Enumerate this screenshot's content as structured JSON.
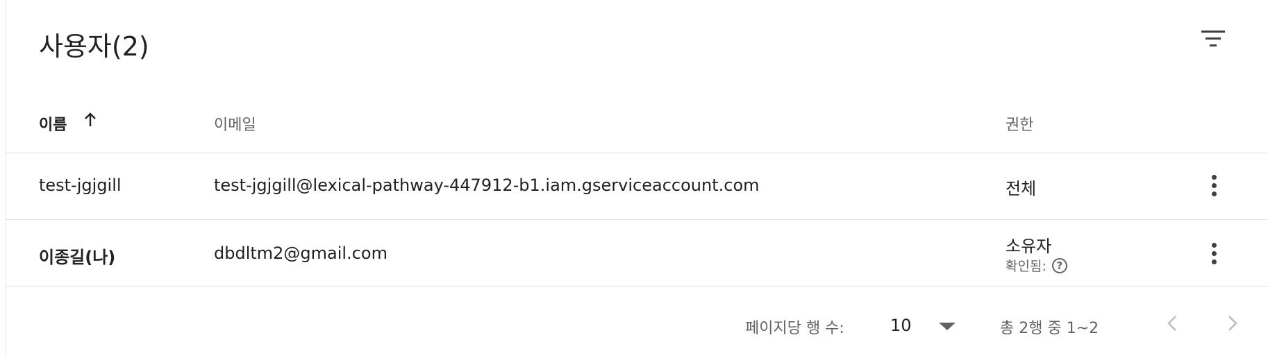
{
  "header": {
    "title": "사용자(2)",
    "filter_icon": "filter-list-icon"
  },
  "columns": {
    "name": "이름",
    "email": "이메일",
    "role": "권한",
    "sort_icon": "arrow-up-icon"
  },
  "rows": [
    {
      "name": "test-jgjgill",
      "email": "test-jgjgill@lexical-pathway-447912-b1.iam.gserviceaccount.com",
      "role": "전체"
    },
    {
      "name": "이종길(나)",
      "email": "dbdltm2@gmail.com",
      "role": "소유자",
      "role_sub": "확인됨:",
      "help_icon_text": "?"
    }
  ],
  "footer": {
    "rows_per_page_label": "페이지당 행 수:",
    "rows_per_page_value": "10",
    "range_text": "총 2행 중 1~2"
  },
  "colors": {
    "text": "#202124",
    "secondary": "#5f6368",
    "divider": "#e0e0e0",
    "disabled": "#bdbdbd"
  }
}
